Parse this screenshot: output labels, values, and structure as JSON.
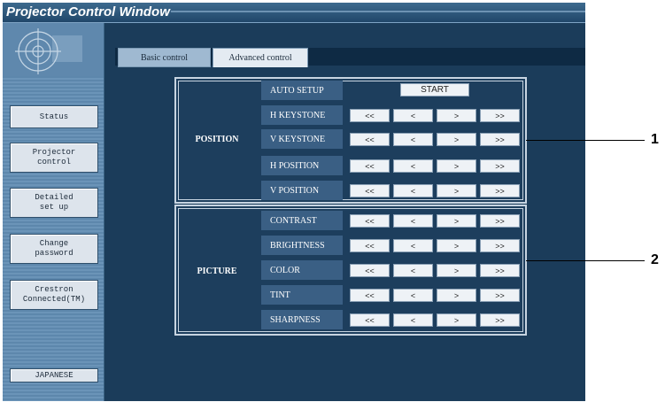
{
  "window": {
    "title": "Projector Control Window"
  },
  "sidebar": {
    "items": [
      {
        "label": "Status"
      },
      {
        "label": "Projector\ncontrol"
      },
      {
        "label": "Detailed\nset up"
      },
      {
        "label": "Change\npassword"
      },
      {
        "label": "Crestron\nConnected(TM)"
      },
      {
        "label": "JAPANESE"
      }
    ]
  },
  "tabs": [
    {
      "label": "Basic control"
    },
    {
      "label": "Advanced control"
    }
  ],
  "position": {
    "label": "POSITION",
    "rows": [
      {
        "label": "AUTO SETUP",
        "action": "START"
      },
      {
        "label": "H KEYSTONE",
        "buttons": [
          "<<",
          "<",
          ">",
          ">>"
        ]
      },
      {
        "label": "V KEYSTONE",
        "buttons": [
          "<<",
          "<",
          ">",
          ">>"
        ]
      },
      {
        "label": "H POSITION",
        "buttons": [
          "<<",
          "<",
          ">",
          ">>"
        ]
      },
      {
        "label": "V POSITION",
        "buttons": [
          "<<",
          "<",
          ">",
          ">>"
        ]
      }
    ]
  },
  "picture": {
    "label": "PICTURE",
    "rows": [
      {
        "label": "CONTRAST",
        "buttons": [
          "<<",
          "<",
          ">",
          ">>"
        ]
      },
      {
        "label": "BRIGHTNESS",
        "buttons": [
          "<<",
          "<",
          ">",
          ">>"
        ]
      },
      {
        "label": "COLOR",
        "buttons": [
          "<<",
          "<",
          ">",
          ">>"
        ]
      },
      {
        "label": "TINT",
        "buttons": [
          "<<",
          "<",
          ">",
          ">>"
        ]
      },
      {
        "label": "SHARPNESS",
        "buttons": [
          "<<",
          "<",
          ">",
          ">>"
        ]
      }
    ]
  },
  "callouts": [
    "1",
    "2"
  ]
}
